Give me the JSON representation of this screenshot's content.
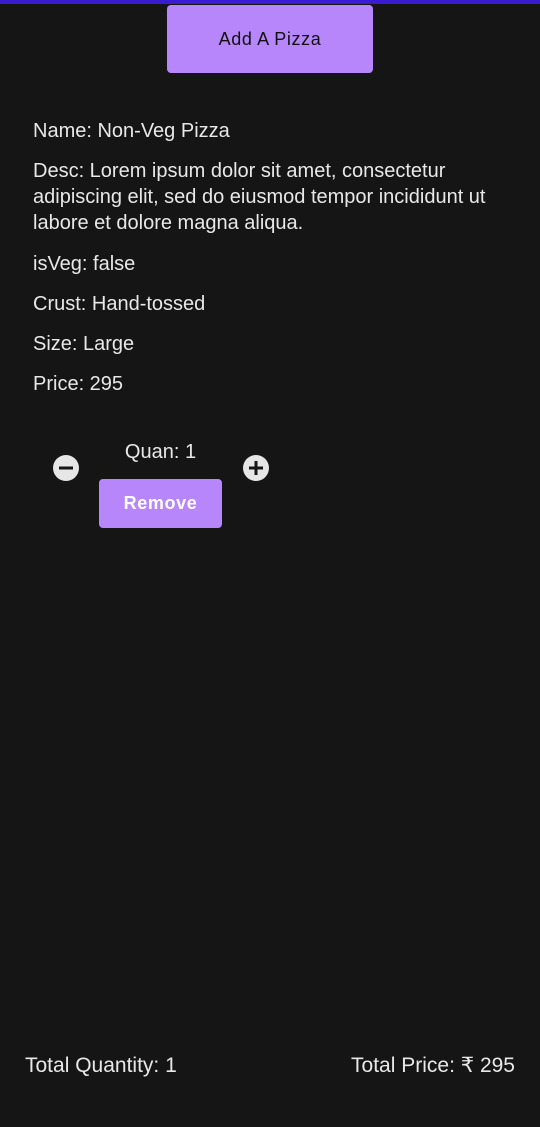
{
  "colors": {
    "background": "#151515",
    "accent": "#b686fa",
    "top_strip": "#3a1bd0",
    "text": "#e8e8e8"
  },
  "header": {
    "add_button_label": "Add A Pizza"
  },
  "pizza": {
    "name_line": "Name: Non-Veg Pizza",
    "desc_line": "Desc: Lorem ipsum dolor sit amet, consectetur adipiscing elit, sed do eiusmod tempor incididunt ut labore et dolore magna aliqua.",
    "isveg_line": "isVeg: false",
    "crust_line": "Crust: Hand-tossed",
    "size_line": "Size: Large",
    "price_line": "Price: 295"
  },
  "cart_item": {
    "quantity_line": "Quan: 1",
    "decrease_icon": "minus-circle-icon",
    "increase_icon": "plus-circle-icon",
    "remove_label": "Remove"
  },
  "footer": {
    "total_quantity": "Total Quantity: 1",
    "total_price": "Total Price: ₹ 295"
  }
}
